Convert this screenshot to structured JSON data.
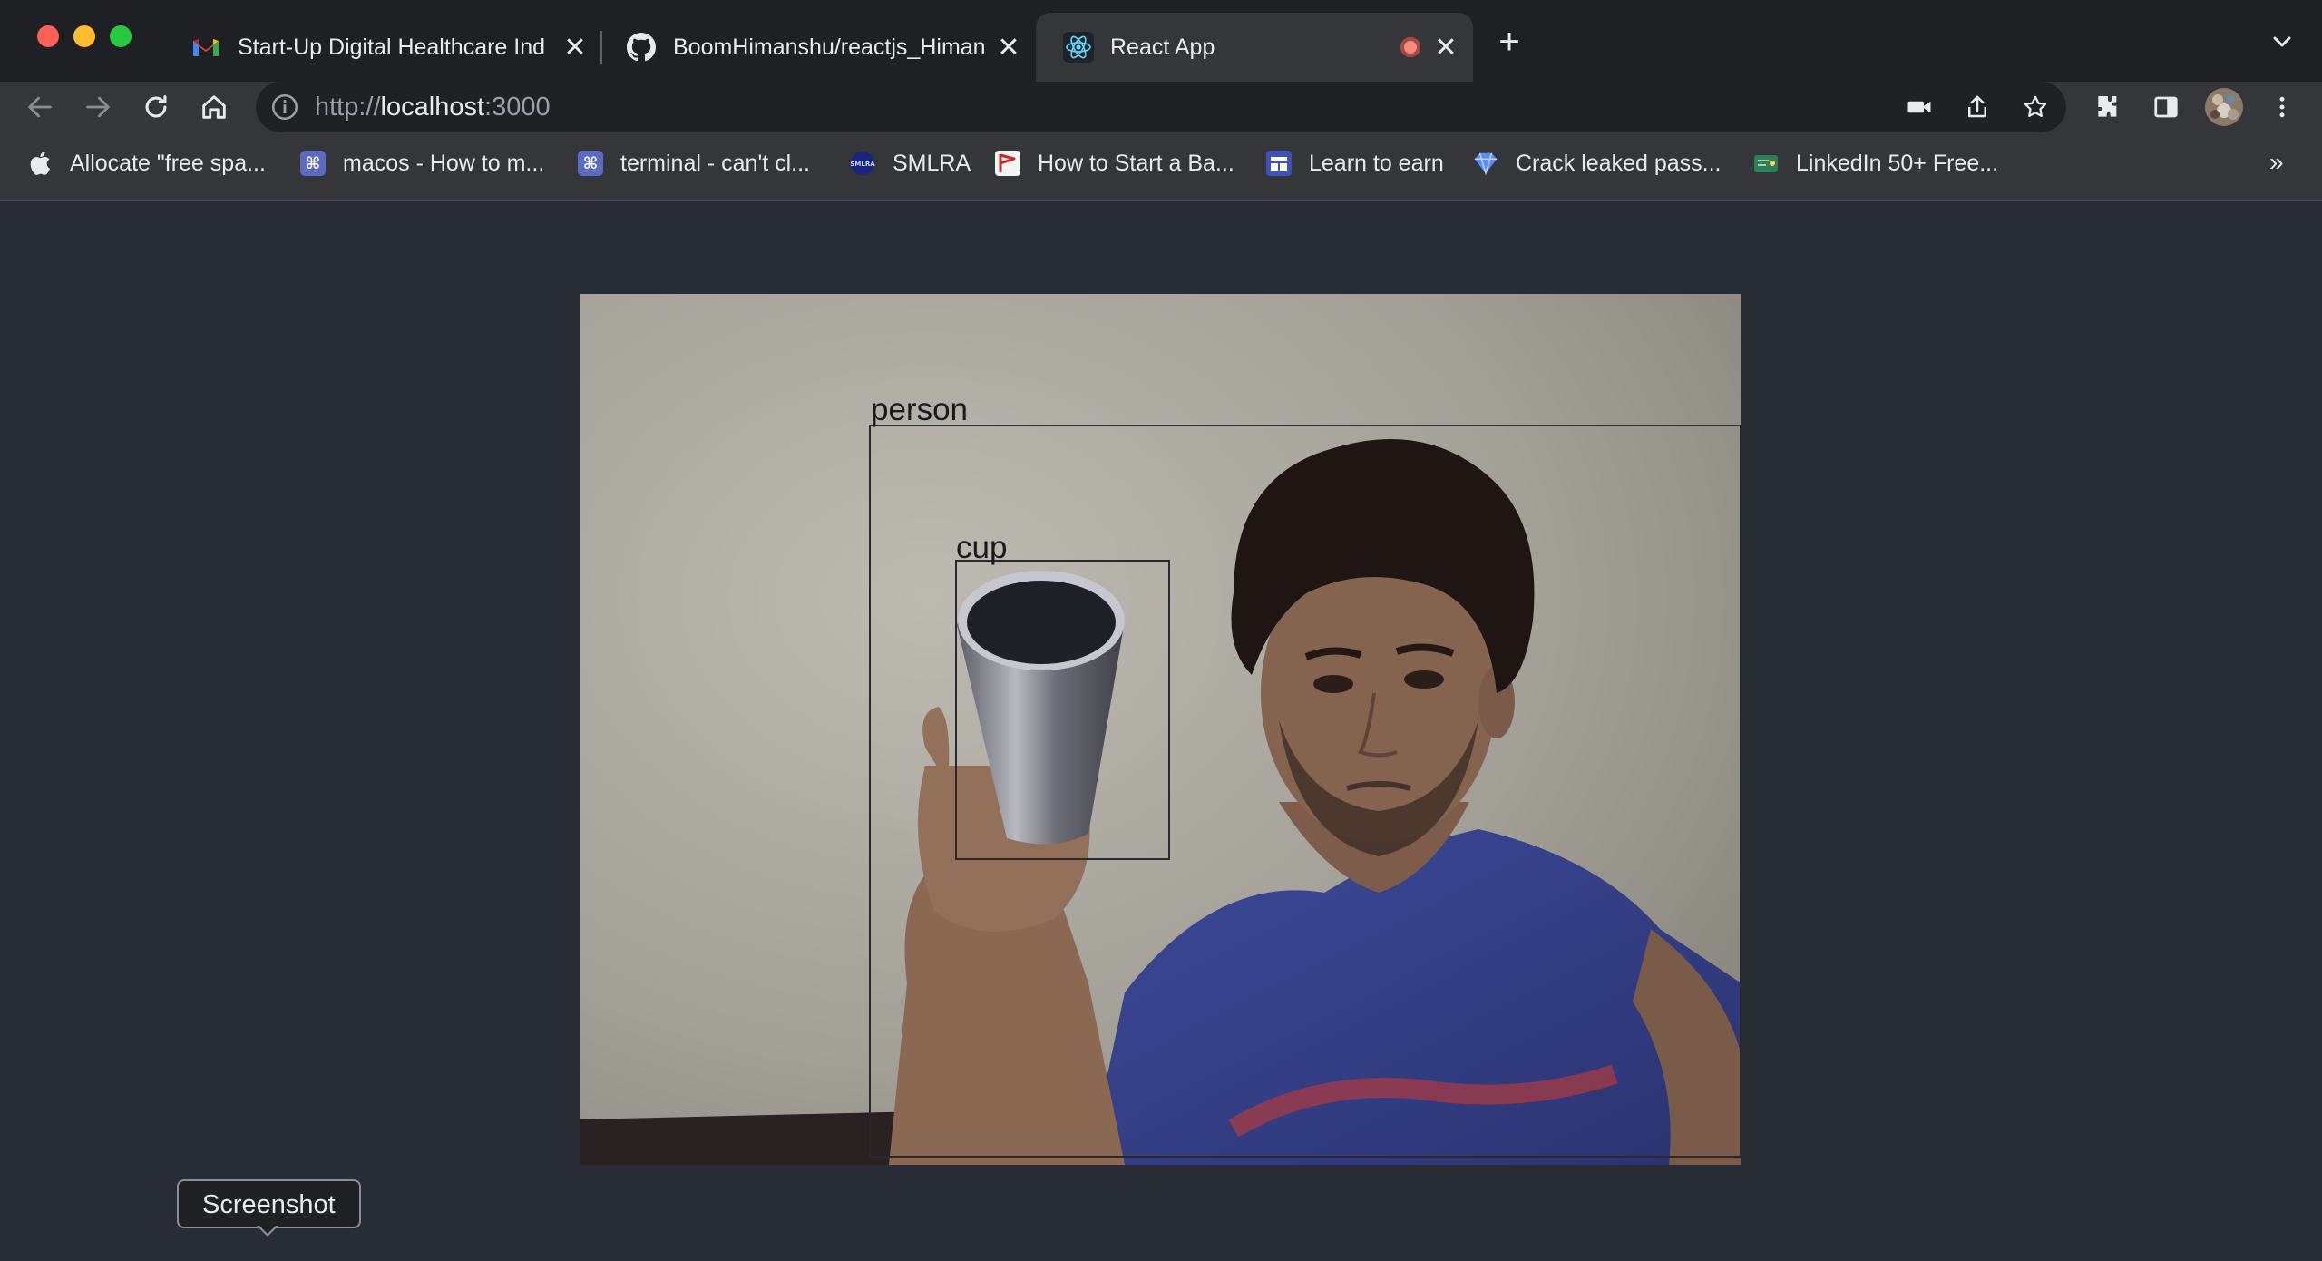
{
  "window": {
    "tabs": [
      {
        "title": "Start-Up Digital Healthcare Ind",
        "icon": "gmail-icon"
      },
      {
        "title": "BoomHimanshu/reactjs_Himan",
        "icon": "github-icon"
      },
      {
        "title": "React App",
        "icon": "react-icon",
        "active": true,
        "recording": true
      }
    ],
    "new_tab_label": "+"
  },
  "toolbar": {
    "url_scheme": "http://",
    "url_host": "localhost",
    "url_port": ":3000"
  },
  "bookmarks": {
    "items": [
      {
        "label": "Allocate \"free spa...",
        "icon": "apple-icon"
      },
      {
        "label": "macos - How to m...",
        "icon": "command-key-icon"
      },
      {
        "label": "terminal - can't cl...",
        "icon": "command-key-icon"
      },
      {
        "label": "SMLRA",
        "icon": "smlra-icon"
      },
      {
        "label": "How to Start a Ba...",
        "icon": "flag-icon"
      },
      {
        "label": "Learn to earn",
        "icon": "calendar-icon"
      },
      {
        "label": "Crack leaked pass...",
        "icon": "gem-icon"
      },
      {
        "label": "LinkedIn 50+ Free...",
        "icon": "certificate-icon"
      }
    ],
    "overflow_label": "»"
  },
  "detections": [
    {
      "label": "person"
    },
    {
      "label": "cup"
    }
  ],
  "tooltip": {
    "text": "Screenshot"
  },
  "colors": {
    "page_background": "#282c34",
    "tab_strip": "#1f2023",
    "toolbar": "#35363a"
  }
}
